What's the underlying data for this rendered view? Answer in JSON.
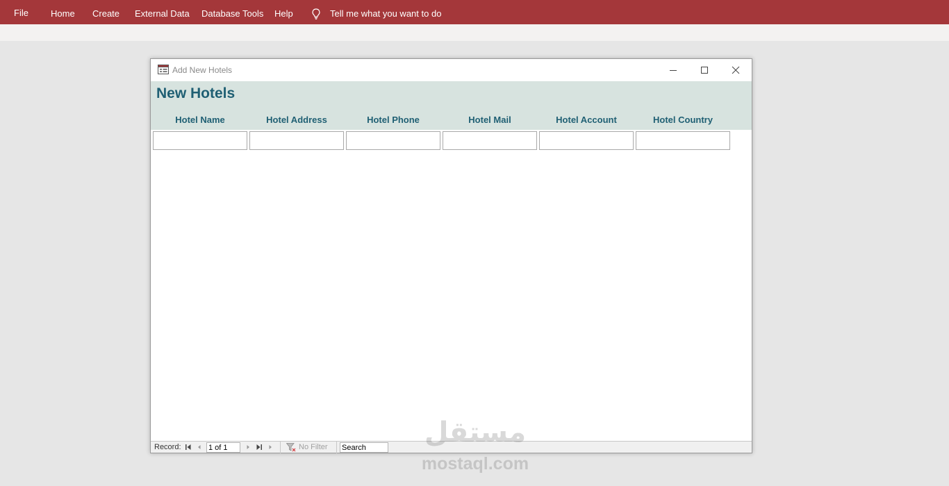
{
  "ribbon": {
    "tabs": [
      "File",
      "Home",
      "Create",
      "External Data",
      "Database Tools",
      "Help"
    ],
    "tell_me": "Tell me what you want to do",
    "bulb_icon": "lightbulb-icon",
    "background_color": "#a4373a"
  },
  "form": {
    "window_title": "Add New Hotels",
    "window_icon": "form-icon",
    "controls": [
      "minimize-icon",
      "maximize-icon",
      "close-icon"
    ],
    "heading": "New Hotels",
    "header_color": "#d7e3df",
    "heading_color": "#1f5f73",
    "columns": [
      "Hotel Name",
      "Hotel Address",
      "Hotel Phone",
      "Hotel Mail",
      "Hotel Account",
      "Hotel Country"
    ],
    "values": [
      "",
      "",
      "",
      "",
      "",
      ""
    ]
  },
  "navigation": {
    "record_label": "Record:",
    "record_value": "1 of 1",
    "filter_label": "No Filter",
    "filter_icon": "filter-icon",
    "search_value": "Search"
  },
  "watermark": {
    "arabic": "مستقل",
    "latin": "mostaql.com"
  }
}
